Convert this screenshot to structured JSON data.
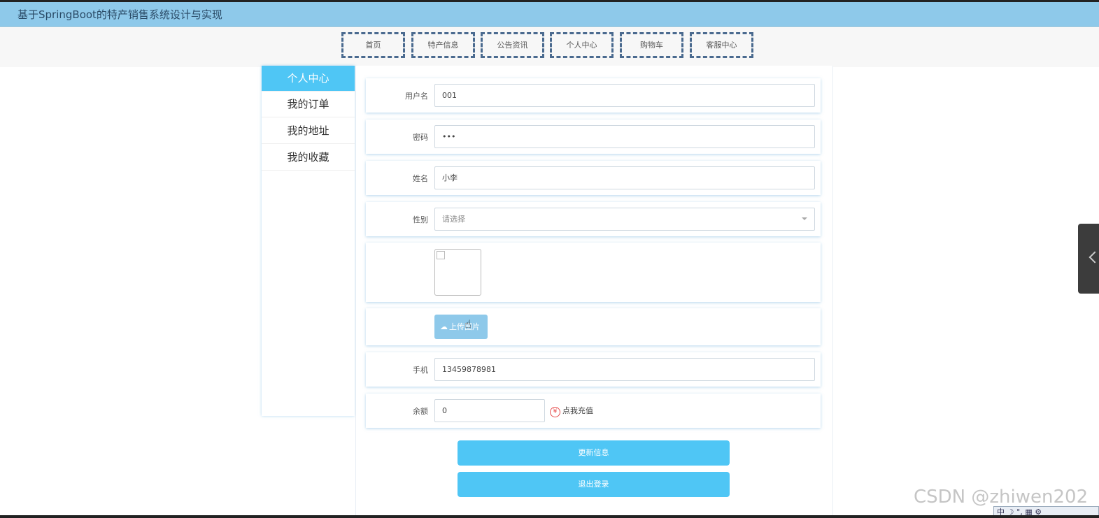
{
  "header": {
    "title": "基于SpringBoot的特产销售系统设计与实现"
  },
  "nav": {
    "items": [
      "首页",
      "特产信息",
      "公告资讯",
      "个人中心",
      "购物车",
      "客服中心"
    ]
  },
  "sidebar": {
    "items": [
      {
        "label": "个人中心",
        "active": true
      },
      {
        "label": "我的订单",
        "active": false
      },
      {
        "label": "我的地址",
        "active": false
      },
      {
        "label": "我的收藏",
        "active": false
      }
    ]
  },
  "form": {
    "username": {
      "label": "用户名",
      "value": "001"
    },
    "password": {
      "label": "密码",
      "value": "•••"
    },
    "name": {
      "label": "姓名",
      "value": "小李"
    },
    "gender": {
      "label": "性别",
      "placeholder": "请选择"
    },
    "upload": {
      "label": "上传图片"
    },
    "phone": {
      "label": "手机",
      "value": "13459878981"
    },
    "balance": {
      "label": "余额",
      "value": "0",
      "recharge_label": "点我充值",
      "recharge_icon": "¥"
    }
  },
  "actions": {
    "update_label": "更新信息",
    "logout_label": "退出登录"
  },
  "watermark": "CSDN @zhiwen202",
  "tray": {
    "text": "中 ☽ °, ▦ ⚙"
  },
  "colors": {
    "accent": "#4fc6f5",
    "topbar": "#8ec9ea"
  }
}
